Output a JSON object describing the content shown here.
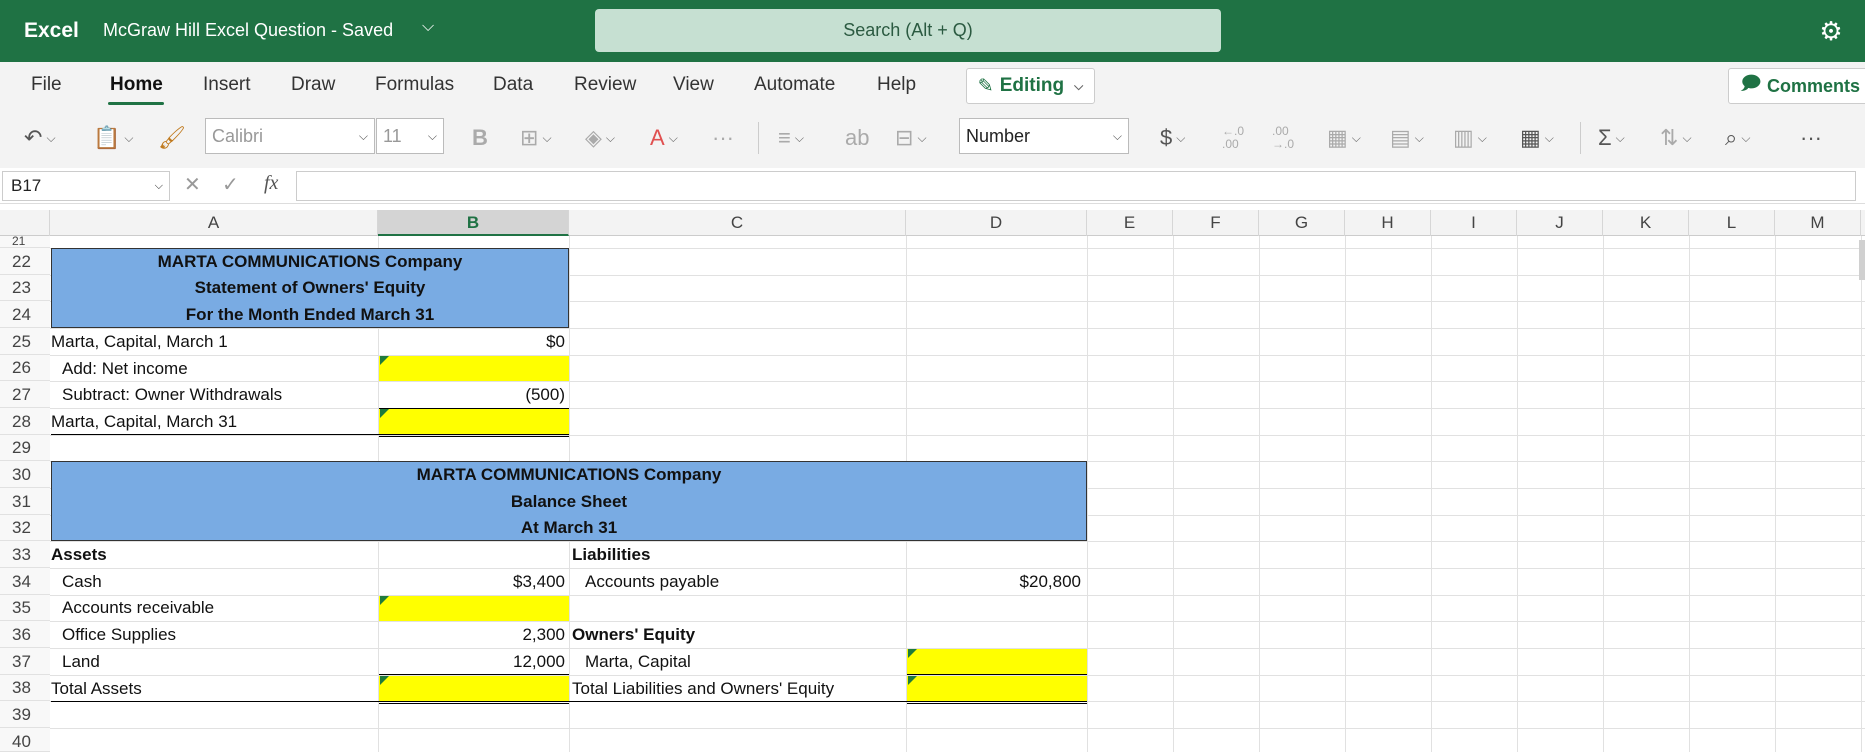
{
  "titlebar": {
    "app": "Excel",
    "doc": "McGraw Hill Excel Question  -  Saved",
    "search": "Search (Alt + Q)"
  },
  "tabs": [
    "File",
    "Home",
    "Insert",
    "Draw",
    "Formulas",
    "Data",
    "Review",
    "View",
    "Automate",
    "Help"
  ],
  "editing": "Editing",
  "comments": "Comments",
  "toolbar": {
    "font": "Calibri",
    "size": "11",
    "bold": "B",
    "number_format": "Number",
    "currency": "$",
    "inc_dec": "←.0\n.00",
    "dec_dec": ".00\n→.0"
  },
  "namebox": "B17",
  "fx": "fx",
  "columns": [
    "A",
    "B",
    "C",
    "D",
    "E",
    "F",
    "G",
    "H",
    "I",
    "J",
    "K",
    "L",
    "M"
  ],
  "rows": [
    "21",
    "22",
    "23",
    "24",
    "25",
    "26",
    "27",
    "28",
    "29",
    "30",
    "31",
    "32",
    "33",
    "34",
    "35",
    "36",
    "37",
    "38",
    "39",
    "40"
  ],
  "equity": {
    "title": "MARTA COMMUNICATIONS Company",
    "subtitle": "Statement of Owners' Equity",
    "period": "For the Month Ended  March 31",
    "r25a": "Marta, Capital, March 1",
    "r25b": "$0",
    "r26a": "Add: Net income",
    "r27a": "Subtract: Owner Withdrawals",
    "r27b": "(500)",
    "r28a": "Marta, Capital, March 31"
  },
  "balance": {
    "title": "MARTA COMMUNICATIONS Company",
    "subtitle": "Balance Sheet",
    "period": "At March 31",
    "assets": "Assets",
    "liabilities": "Liabilities",
    "cash": "Cash",
    "cash_v": "$3,400",
    "ap": "Accounts payable",
    "ap_v": "$20,800",
    "ar": "Accounts receivable",
    "os": "Office Supplies",
    "os_v": "2,300",
    "oe": "Owners' Equity",
    "land": "Land",
    "land_v": "12,000",
    "mc": "Marta, Capital",
    "ta": "Total Assets",
    "tloe": "Total Liabilities and Owners' Equity"
  }
}
